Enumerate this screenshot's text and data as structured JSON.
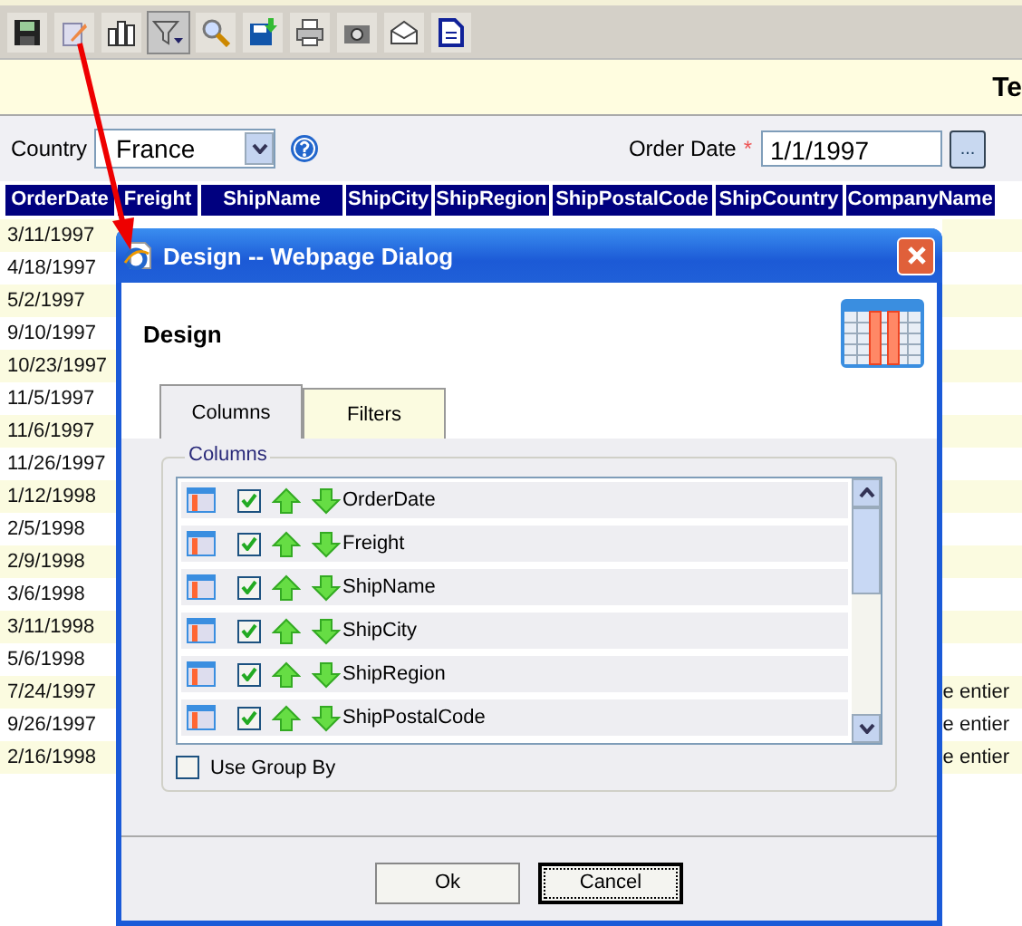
{
  "toolbar": {
    "buttons": [
      {
        "kind": "save",
        "selected": false
      },
      {
        "kind": "edit",
        "selected": false
      },
      {
        "kind": "chart",
        "selected": false
      },
      {
        "kind": "filter",
        "selected": true
      },
      {
        "kind": "search",
        "selected": false
      },
      {
        "kind": "export",
        "selected": false
      },
      {
        "kind": "print",
        "selected": false
      },
      {
        "kind": "camera",
        "selected": false
      },
      {
        "kind": "mail",
        "selected": false
      },
      {
        "kind": "document",
        "selected": false
      }
    ]
  },
  "report_title": "Te",
  "filters": {
    "country_label": "Country",
    "country_value": "France",
    "date_label": "Order Date",
    "required_mark": "*",
    "date_value": "1/1/1997",
    "date_button": "..."
  },
  "grid": {
    "columns": [
      "OrderDate",
      "Freight",
      "ShipName",
      "ShipCity",
      "ShipRegion",
      "ShipPostalCode",
      "ShipCountry",
      "CompanyName"
    ],
    "rows": [
      {
        "order_date": "3/11/1997"
      },
      {
        "order_date": "4/18/1997"
      },
      {
        "order_date": "5/2/1997"
      },
      {
        "order_date": "9/10/1997"
      },
      {
        "order_date": "10/23/1997"
      },
      {
        "order_date": "11/5/1997"
      },
      {
        "order_date": "11/6/1997"
      },
      {
        "order_date": "11/26/1997"
      },
      {
        "order_date": "1/12/1998"
      },
      {
        "order_date": "2/5/1998"
      },
      {
        "order_date": "2/9/1998"
      },
      {
        "order_date": "3/6/1998"
      },
      {
        "order_date": "3/11/1998"
      },
      {
        "order_date": "5/6/1998"
      },
      {
        "order_date": "7/24/1997",
        "company_name": "e entier"
      },
      {
        "order_date": "9/26/1997",
        "company_name": "e entier"
      },
      {
        "order_date": "2/16/1998",
        "company_name": "e entier"
      }
    ]
  },
  "dialog": {
    "title": "Design -- Webpage Dialog",
    "heading": "Design",
    "tabs": [
      {
        "label": "Columns",
        "selected": true
      },
      {
        "label": "Filters",
        "selected": false
      }
    ],
    "legend": "Columns",
    "columns": [
      {
        "name": "OrderDate",
        "checked": true
      },
      {
        "name": "Freight",
        "checked": true
      },
      {
        "name": "ShipName",
        "checked": true
      },
      {
        "name": "ShipCity",
        "checked": true
      },
      {
        "name": "ShipRegion",
        "checked": true
      },
      {
        "name": "ShipPostalCode",
        "checked": true
      }
    ],
    "use_group_by": {
      "label": "Use Group By",
      "checked": false
    },
    "buttons": [
      {
        "label": "Ok",
        "focused": false
      },
      {
        "label": "Cancel",
        "focused": true
      }
    ]
  }
}
